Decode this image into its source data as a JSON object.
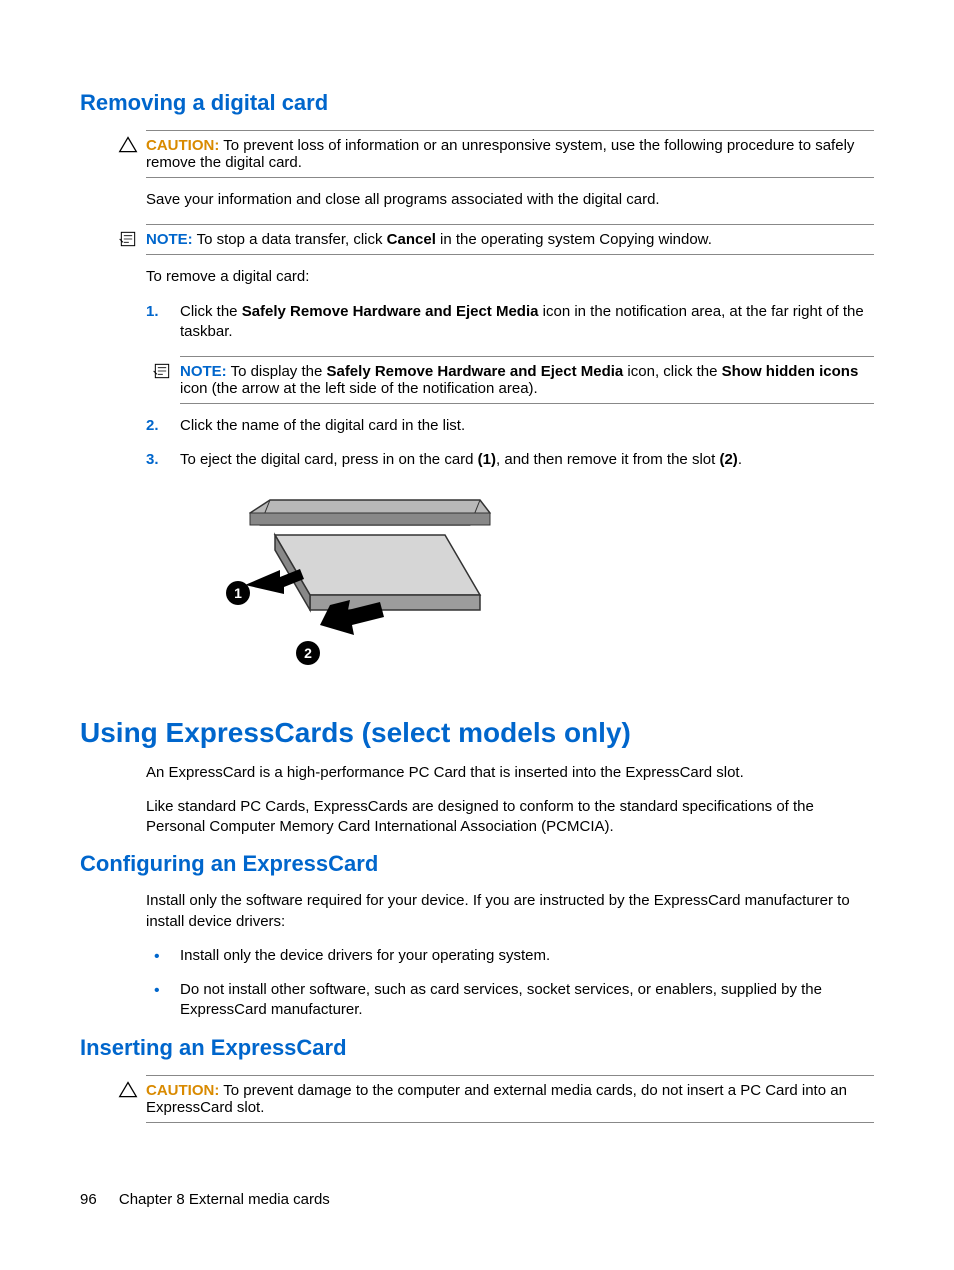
{
  "section1": {
    "heading": "Removing a digital card",
    "caution_label": "CAUTION:",
    "caution_text": "To prevent loss of information or an unresponsive system, use the following procedure to safely remove the digital card.",
    "para1": "Save your information and close all programs associated with the digital card.",
    "note1_label": "NOTE:",
    "note1_pre": "To stop a data transfer, click ",
    "note1_bold": "Cancel",
    "note1_post": " in the operating system Copying window.",
    "para2": "To remove a digital card:",
    "step1_num": "1.",
    "step1_pre": "Click the ",
    "step1_bold": "Safely Remove Hardware and Eject Media",
    "step1_post": " icon in the notification area, at the far right of the taskbar.",
    "note2_label": "NOTE:",
    "note2_pre": "To display the ",
    "note2_bold1": "Safely Remove Hardware and Eject Media",
    "note2_mid": " icon, click the ",
    "note2_bold2": "Show hidden icons",
    "note2_post": " icon (the arrow at the left side of the notification area).",
    "step2_num": "2.",
    "step2_text": "Click the name of the digital card in the list.",
    "step3_num": "3.",
    "step3_pre": "To eject the digital card, press in on the card ",
    "step3_bold1": "(1)",
    "step3_mid": ", and then remove it from the slot ",
    "step3_bold2": "(2)",
    "step3_post": "."
  },
  "section2": {
    "heading": "Using ExpressCards (select models only)",
    "para1": "An ExpressCard is a high-performance PC Card that is inserted into the ExpressCard slot.",
    "para2": "Like standard PC Cards, ExpressCards are designed to conform to the standard specifications of the Personal Computer Memory Card International Association (PCMCIA)."
  },
  "section3": {
    "heading": "Configuring an ExpressCard",
    "para1": "Install only the software required for your device. If you are instructed by the ExpressCard manufacturer to install device drivers:",
    "bullet1": "Install only the device drivers for your operating system.",
    "bullet2": "Do not install other software, such as card services, socket services, or enablers, supplied by the ExpressCard manufacturer."
  },
  "section4": {
    "heading": "Inserting an ExpressCard",
    "caution_label": "CAUTION:",
    "caution_text": "To prevent damage to the computer and external media cards, do not insert a PC Card into an ExpressCard slot."
  },
  "footer": {
    "page": "96",
    "chapter": "Chapter 8   External media cards"
  }
}
